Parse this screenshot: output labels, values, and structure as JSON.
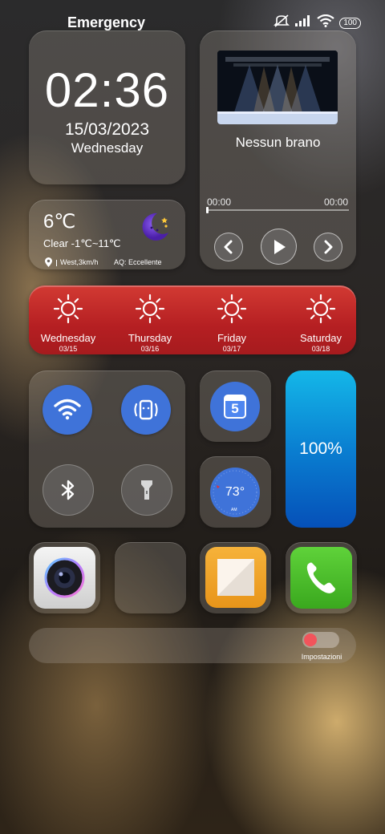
{
  "status_bar": {
    "carrier": "Emergency",
    "battery": "100",
    "icons": [
      "mute-icon",
      "signal-icon",
      "wifi-icon",
      "battery-icon"
    ]
  },
  "clock": {
    "time": "02:36",
    "date": "15/03/2023",
    "day": "Wednesday"
  },
  "music": {
    "title": "Nessun brano",
    "elapsed": "00:00",
    "duration": "00:00",
    "progress": 0
  },
  "weather": {
    "temp": "6℃",
    "desc": "Clear -1℃~11℃",
    "wind": "West,3km/h",
    "air_quality": "AQ: Eccellente"
  },
  "forecast": [
    {
      "day": "Wednesday",
      "date": "03/15",
      "icon": "sun-icon"
    },
    {
      "day": "Thursday",
      "date": "03/16",
      "icon": "sun-icon"
    },
    {
      "day": "Friday",
      "date": "03/17",
      "icon": "sun-icon"
    },
    {
      "day": "Saturday",
      "date": "03/18",
      "icon": "sun-icon"
    }
  ],
  "toggles": [
    {
      "name": "wifi",
      "on": true
    },
    {
      "name": "auto-rotate",
      "on": true
    },
    {
      "name": "bluetooth",
      "on": false
    },
    {
      "name": "flashlight",
      "on": false
    }
  ],
  "calendar": {
    "day": "5"
  },
  "thermometer": {
    "temp": "73°"
  },
  "battery_widget": {
    "level": "100%",
    "level_fraction": 1.0
  },
  "settings": {
    "label": "Impostazioni"
  },
  "colors": {
    "forecast_bg": "#b51f22",
    "toggle_on": "#3f73d9",
    "battery_top": "#14b7e8",
    "battery_bottom": "#0550b8"
  }
}
